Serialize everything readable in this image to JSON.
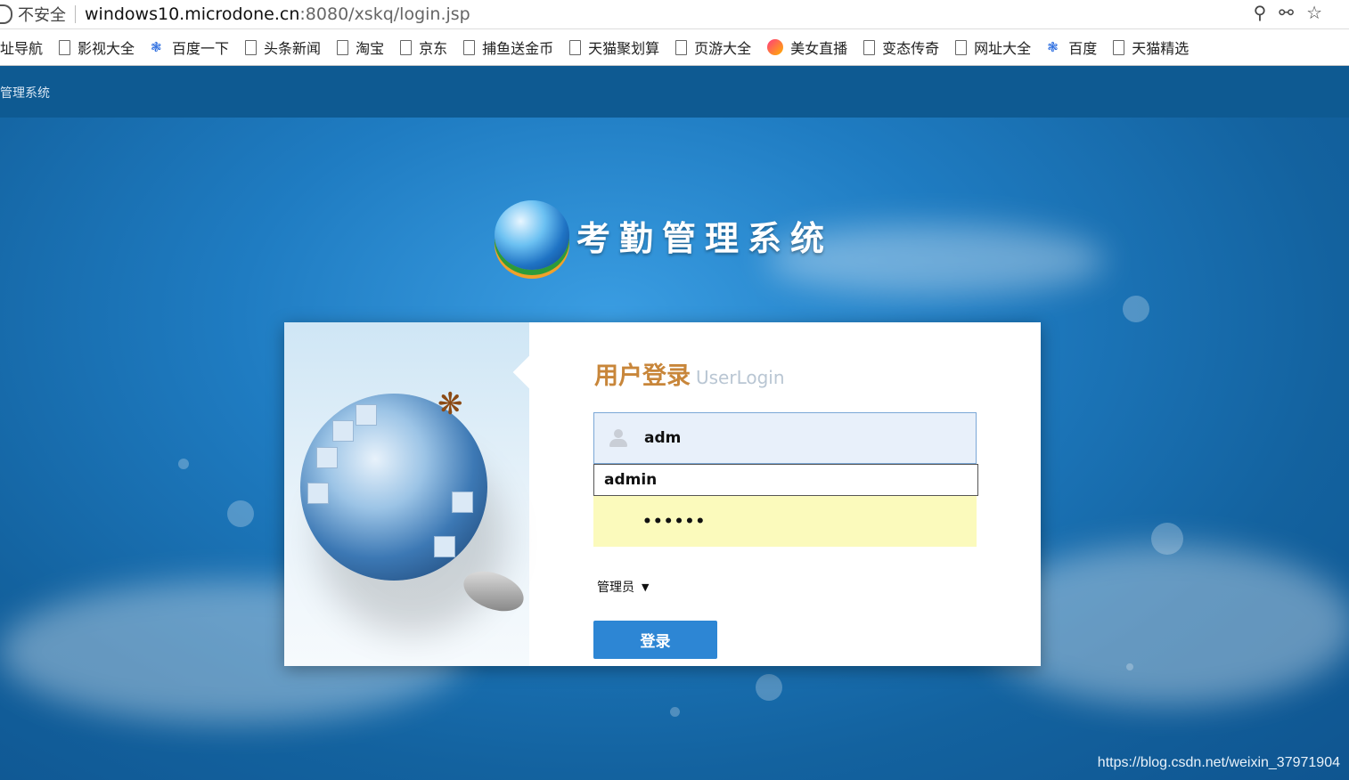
{
  "browser": {
    "security_label": "不安全",
    "url_host": "windows10.microdone.cn",
    "url_path": ":8080/xskq/login.jsp",
    "icons": [
      "zoom-icon",
      "key-icon",
      "star-icon"
    ]
  },
  "bookmarks": [
    {
      "label": "址导航",
      "icon": "none"
    },
    {
      "label": "影视大全",
      "icon": "page-icon"
    },
    {
      "label": "百度一下",
      "icon": "baidu-paw-icon"
    },
    {
      "label": "头条新闻",
      "icon": "page-icon"
    },
    {
      "label": "淘宝",
      "icon": "page-icon"
    },
    {
      "label": "京东",
      "icon": "page-icon"
    },
    {
      "label": "捕鱼送金币",
      "icon": "page-icon"
    },
    {
      "label": "天猫聚划算",
      "icon": "page-icon"
    },
    {
      "label": "页游大全",
      "icon": "page-icon"
    },
    {
      "label": "美女直播",
      "icon": "live-icon"
    },
    {
      "label": "变态传奇",
      "icon": "page-icon"
    },
    {
      "label": "网址大全",
      "icon": "page-icon"
    },
    {
      "label": "百度",
      "icon": "baidu-paw-icon"
    },
    {
      "label": "天猫精选",
      "icon": "page-icon"
    }
  ],
  "app": {
    "header_title": "管理系统",
    "logo_title": "考勤管理系统"
  },
  "login": {
    "title_cn": "用户登录",
    "title_en": "UserLogin",
    "username_value": "adm",
    "autocomplete_option": "admin",
    "password_mask": "••••••",
    "role_selected": "管理员",
    "submit_label": "登录"
  },
  "watermark": "https://blog.csdn.net/weixin_37971904",
  "colors": {
    "header_bg": "#0e5a92",
    "title_accent": "#c8863a",
    "button_bg": "#2d86d4",
    "autofill_bg": "#fbfabc"
  }
}
